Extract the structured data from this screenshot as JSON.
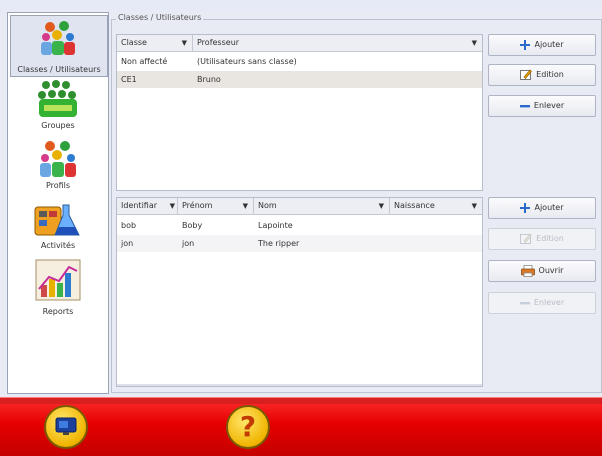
{
  "sidebar": {
    "items": [
      {
        "label": "Classes / Utilisateurs",
        "icon": "users-icon",
        "active": true
      },
      {
        "label": "Groupes",
        "icon": "groups-icon"
      },
      {
        "label": "Profils",
        "icon": "profiles-icon"
      },
      {
        "label": "Activités",
        "icon": "activities-icon"
      },
      {
        "label": "Reports",
        "icon": "reports-chart-icon"
      }
    ]
  },
  "groupbox": {
    "title": "Classes / Utilisateurs"
  },
  "classes_table": {
    "columns": [
      "Classe",
      "Professeur"
    ],
    "rows": [
      {
        "classe": "Non affecté",
        "professeur": "(Utilisateurs sans classe)"
      },
      {
        "classe": "CE1",
        "professeur": "Bruno",
        "selected": true
      }
    ]
  },
  "class_buttons": {
    "add": "Ajouter",
    "edit": "Edition",
    "remove": "Enlever"
  },
  "users_table": {
    "columns": [
      "Identifiar",
      "Prénom",
      "Nom",
      "Naissance"
    ],
    "rows": [
      {
        "id": "bob",
        "prenom": "Boby",
        "nom": "Lapointe",
        "naissance": ""
      },
      {
        "id": "jon",
        "prenom": "jon",
        "nom": "The ripper",
        "naissance": ""
      }
    ]
  },
  "user_buttons": {
    "add": "Ajouter",
    "edit": "Edition",
    "open": "Ouvrir",
    "remove": "Enlever"
  },
  "bottom": {
    "help_glyph": "?",
    "icons": [
      "screen-icon",
      "help-icon"
    ]
  },
  "colors": {
    "bottom_bar": "#e60000",
    "accent_blue": "#2b6acb",
    "round_button": "#f0b400"
  }
}
